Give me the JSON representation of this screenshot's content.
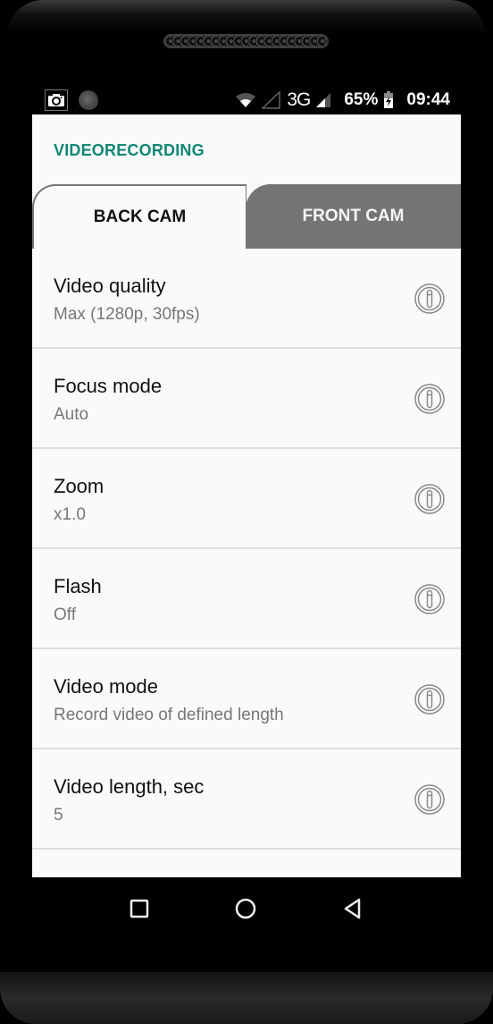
{
  "status_bar": {
    "left_icons": [
      "camera-icon",
      "recording-disc-icon"
    ],
    "network_type": "3G",
    "battery_percent": "65%",
    "time": "09:44",
    "icons": [
      "wifi-icon",
      "signal-empty-icon",
      "signal-icon",
      "battery-charging-icon"
    ]
  },
  "app": {
    "title": "VIDEORECORDING",
    "accent_color": "#128775"
  },
  "tabs": [
    {
      "label": "BACK CAM",
      "active": true
    },
    {
      "label": "FRONT CAM",
      "active": false
    }
  ],
  "settings": [
    {
      "title": "Video quality",
      "value": "Max (1280p, 30fps)",
      "icon": "info-icon"
    },
    {
      "title": "Focus mode",
      "value": "Auto",
      "icon": "info-icon"
    },
    {
      "title": "Zoom",
      "value": "x1.0",
      "icon": "info-icon"
    },
    {
      "title": "Flash",
      "value": "Off",
      "icon": "info-icon"
    },
    {
      "title": "Video mode",
      "value": "Record video of defined length",
      "icon": "info-icon"
    },
    {
      "title": "Video length, sec",
      "value": "5",
      "icon": "info-icon"
    }
  ],
  "nav_bar": {
    "buttons": [
      "recents-square-icon",
      "home-circle-icon",
      "back-triangle-icon"
    ]
  }
}
